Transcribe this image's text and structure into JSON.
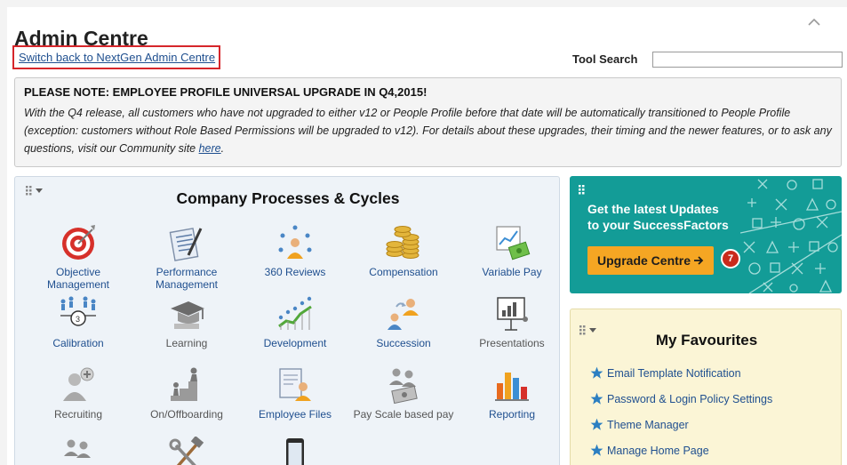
{
  "header": {
    "title": "Admin Centre",
    "switch_link": "Switch back to NextGen Admin Centre",
    "tool_search_label": "Tool Search",
    "tool_search_value": ""
  },
  "notice": {
    "heading": "PLEASE NOTE: EMPLOYEE PROFILE UNIVERSAL UPGRADE IN Q4,2015!",
    "body": "With the Q4 release, all customers who have not upgraded to either v12 or People Profile before that date will be automatically transitioned to People Profile (exception: customers without Role Based Permissions will be upgraded to v12). For details about these upgrades, their timing and the newer features, or to ask any questions, visit our Community site ",
    "link": "here",
    "tail": "."
  },
  "processes": {
    "title": "Company Processes & Cycles",
    "tiles": [
      {
        "label": "Objective Management",
        "icon": "target-icon"
      },
      {
        "label": "Performance Management",
        "icon": "document-pen-icon"
      },
      {
        "label": "360 Reviews",
        "icon": "people-circle-icon"
      },
      {
        "label": "Compensation",
        "icon": "coins-icon"
      },
      {
        "label": "Variable Pay",
        "icon": "chart-money-icon"
      },
      {
        "label": "Calibration",
        "icon": "people-scale-icon"
      },
      {
        "label": "Learning",
        "icon": "graduation-cap-icon"
      },
      {
        "label": "Development",
        "icon": "growth-chart-icon"
      },
      {
        "label": "Succession",
        "icon": "succession-icon"
      },
      {
        "label": "Presentations",
        "icon": "presentation-icon"
      },
      {
        "label": "Recruiting",
        "icon": "person-add-icon"
      },
      {
        "label": "On/Offboarding",
        "icon": "stairs-person-icon"
      },
      {
        "label": "Employee Files",
        "icon": "employee-file-icon"
      },
      {
        "label": "Pay Scale based pay",
        "icon": "payscale-icon"
      },
      {
        "label": "Reporting",
        "icon": "bar-chart-icon"
      }
    ]
  },
  "updates": {
    "line1": "Get the latest Updates",
    "line2": "to your SuccessFactors",
    "button": "Upgrade Centre",
    "badge": "7"
  },
  "favourites": {
    "title": "My Favourites",
    "items": [
      "Email Template Notification",
      "Password & Login Policy Settings",
      "Theme Manager",
      "Manage Home Page"
    ]
  }
}
